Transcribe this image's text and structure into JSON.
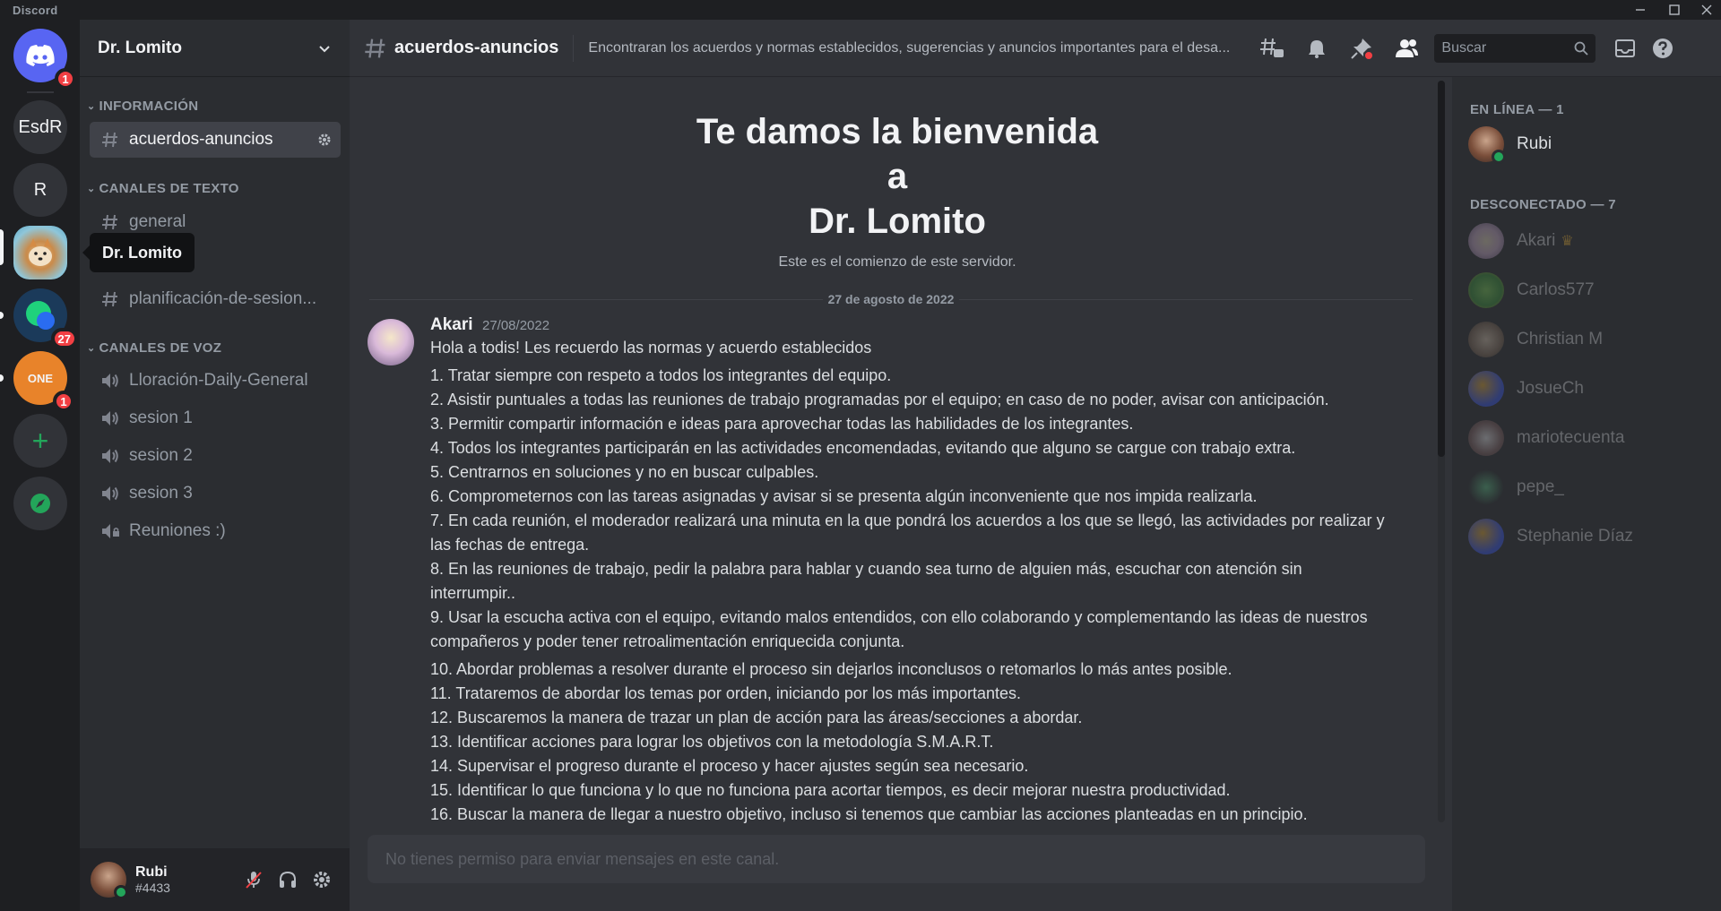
{
  "app": {
    "name": "Discord"
  },
  "servers": {
    "items": [
      {
        "label": "",
        "icon": "discord-logo",
        "badge": "1"
      },
      {
        "label": "EsdR",
        "badge": ""
      },
      {
        "label": "R",
        "badge": ""
      },
      {
        "label": "",
        "icon": "dog-avatar",
        "badge": ""
      },
      {
        "label": "",
        "icon": "green-blob",
        "badge": "27"
      },
      {
        "label": "ONE",
        "badge": "1"
      }
    ],
    "add_label": "+",
    "tooltip": "Dr. Lomito"
  },
  "sidebar": {
    "server_name": "Dr. Lomito",
    "categories": [
      {
        "name": "INFORMACIÓN"
      },
      {
        "name": "CANALES DE TEXTO"
      },
      {
        "name": "CANALES DE VOZ"
      }
    ],
    "info_channels": [
      "acuerdos-anuncios"
    ],
    "text_channels": [
      "general",
      "planificación-de-sesion..."
    ],
    "voice_channels": [
      "Lloración-Daily-General",
      "sesion 1",
      "sesion 2",
      "sesion 3",
      "Reuniones :)"
    ]
  },
  "user": {
    "name": "Rubi",
    "tag": "#4433"
  },
  "header": {
    "channel": "acuerdos-anuncios",
    "topic": "Encontraran los acuerdos y normas establecidos, sugerencias y anuncios importantes para el desa...",
    "search_placeholder": "Buscar"
  },
  "welcome": {
    "line1": "Te damos la bienvenida",
    "line2": "a",
    "line3": "Dr. Lomito",
    "subtitle": "Este es el comienzo de este servidor."
  },
  "date_separator": "27 de agosto de 2022",
  "message": {
    "author": "Akari",
    "timestamp": "27/08/2022",
    "intro": "Hola a todis! Les recuerdo las normas y acuerdo establecidos",
    "items": [
      "1. Tratar siempre con respeto a todos los integrantes del equipo.",
      "2. Asistir puntuales a todas las reuniones de trabajo programadas por el equipo; en caso de no poder, avisar con anticipación.",
      "3. Permitir compartir información e ideas para aprovechar todas las habilidades de los integrantes.",
      "4. Todos los integrantes participarán en las actividades encomendadas, evitando que alguno se cargue con trabajo extra.",
      "5. Centrarnos en soluciones y no en buscar culpables.",
      "6. Comprometernos con las tareas asignadas y avisar si se presenta algún inconveniente que nos impida realizarla.",
      "7. En cada reunión, el moderador realizará una minuta en la que pondrá los acuerdos a los que se llegó, las actividades por realizar y las fechas de entrega.",
      "8. En las reuniones de trabajo, pedir la palabra para hablar y cuando sea turno de alguien más, escuchar con atención sin interrumpir..",
      "9. Usar la escucha activa con el equipo, evitando malos entendidos, con ello colaborando y complementando las ideas de nuestros compañeros y poder tener retroalimentación enriquecida conjunta.",
      "10. Abordar problemas a resolver durante el proceso sin dejarlos inconclusos o retomarlos lo más antes posible.",
      "11. Trataremos de abordar los temas por orden, iniciando por los más importantes.",
      "12. Buscaremos la manera de trazar un plan de acción para las áreas/secciones a abordar.",
      "13. Identificar acciones para lograr los objetivos con la metodología S.M.A.R.T.",
      "14. Supervisar el progreso durante el proceso y hacer ajustes según sea necesario.",
      "15. Identificar lo que funciona y lo que no funciona para acortar tiempos, es decir mejorar nuestra productividad.",
      "16. Buscar la manera de llegar a nuestro objetivo, incluso si tenemos que cambiar las acciones planteadas en un principio."
    ]
  },
  "composer": {
    "placeholder": "No tienes permiso para enviar mensajes en este canal."
  },
  "members": {
    "online_header": "EN LÍNEA — 1",
    "offline_header": "DESCONECTADO — 7",
    "online": [
      {
        "name": "Rubi",
        "color": "#f2f3f5"
      }
    ],
    "offline": [
      {
        "name": "Akari",
        "color": "#dbdee1"
      },
      {
        "name": "Carlos577",
        "color": "#dbdee1"
      },
      {
        "name": "Christian M",
        "color": "#dbdee1"
      },
      {
        "name": "JosueCh",
        "color": "#dbdee1"
      },
      {
        "name": "mariotecuenta",
        "color": "#dbdee1"
      },
      {
        "name": "pepe_",
        "color": "#dbdee1"
      },
      {
        "name": "Stephanie Díaz",
        "color": "#dbdee1"
      }
    ]
  },
  "colors": {
    "accent": "#5865f2",
    "online": "#23a55a",
    "danger": "#f23f43",
    "add_green": "#23a55a"
  }
}
